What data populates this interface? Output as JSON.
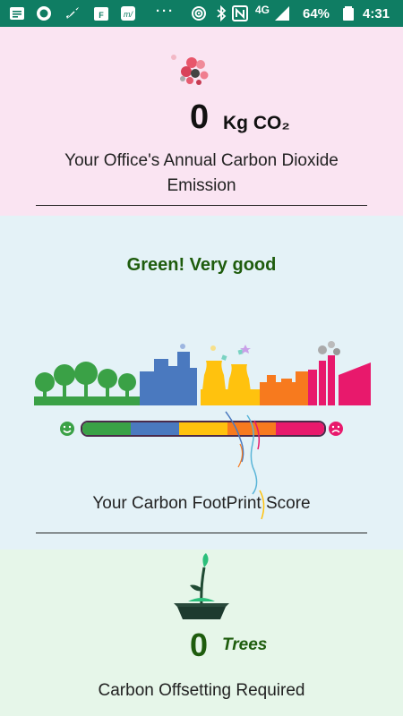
{
  "status_bar": {
    "network": "4G",
    "battery": "64%",
    "time": "4:31",
    "background": "#0f7d63"
  },
  "emission": {
    "value": "0",
    "unit": "Kg CO₂",
    "caption": "Your Office's Annual Carbon Dioxide Emission",
    "background": "#fae4f2"
  },
  "score": {
    "rating": "Green! Very good",
    "caption": "Your Carbon FootPrint Score",
    "background": "#e4f2f7",
    "meter_colors": [
      "#3aa146",
      "#4a79bf",
      "#ffc20e",
      "#f77a1e",
      "#e8196c"
    ]
  },
  "offset": {
    "value": "0",
    "unit": "Trees",
    "caption": "Carbon Offsetting Required",
    "background": "#e6f6e9"
  }
}
